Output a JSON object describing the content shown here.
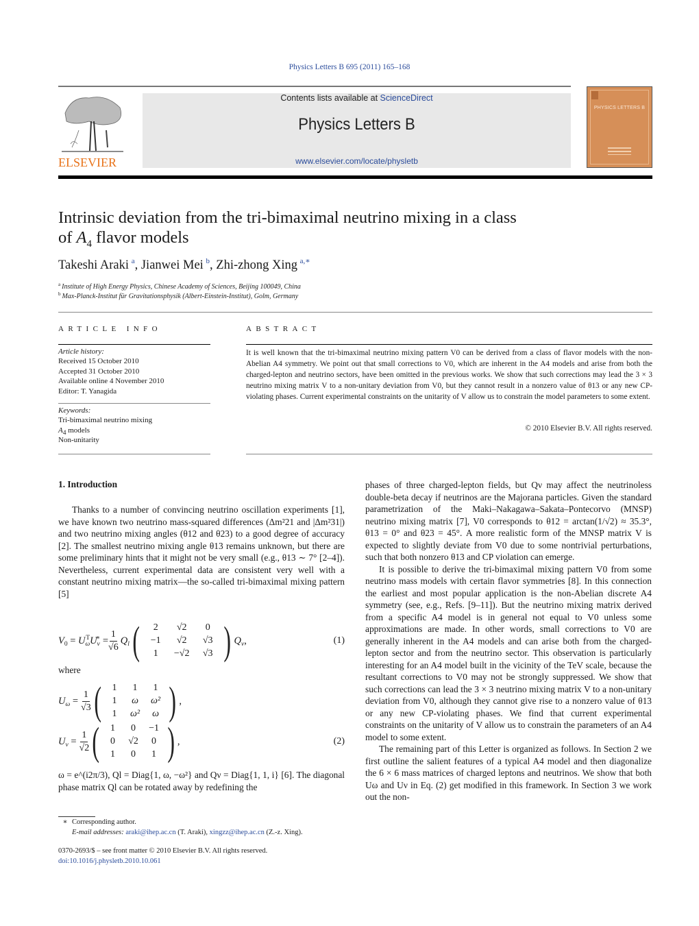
{
  "header": {
    "journal_ref": "Physics Letters B 695 (2011) 165–168",
    "contents_prefix": "Contents lists available at ",
    "contents_link": "ScienceDirect",
    "journal_title": "Physics Letters B",
    "journal_url": "www.elsevier.com/locate/physletb",
    "publisher_logo_text": "ELSEVIER",
    "cover_title": "PHYSICS LETTERS B",
    "colors": {
      "link": "#2b4c9b",
      "elsevier_orange": "#e8731a",
      "cover": "#d68f58",
      "band": "#e8e8e8"
    }
  },
  "article": {
    "title_line1": "Intrinsic deviation from the tri-bimaximal neutrino mixing in a class",
    "title_line2_pre": "of ",
    "title_line2_math": "A",
    "title_line2_sub": "4",
    "title_line2_post": " flavor models",
    "authors": [
      {
        "name": "Takeshi Araki",
        "marks": "a"
      },
      {
        "name": "Jianwei Mei",
        "marks": "b"
      },
      {
        "name": "Zhi-zhong Xing",
        "marks": "a,∗"
      }
    ],
    "affiliations": [
      {
        "mark": "a",
        "text": "Institute of High Energy Physics, Chinese Academy of Sciences, Beijing 100049, China"
      },
      {
        "mark": "b",
        "text": "Max-Planck-Institut für Gravitationsphysik (Albert-Einstein-Institut), Golm, Germany"
      }
    ]
  },
  "article_info": {
    "heading": "ARTICLE INFO",
    "history_label": "Article history:",
    "history": [
      "Received 15 October 2010",
      "Accepted 31 October 2010",
      "Available online 4 November 2010",
      "Editor: T. Yanagida"
    ],
    "keywords_label": "Keywords:",
    "keywords": [
      "Tri-bimaximal neutrino mixing",
      "A4 models",
      "Non-unitarity"
    ]
  },
  "abstract": {
    "heading": "ABSTRACT",
    "text": "It is well known that the tri-bimaximal neutrino mixing pattern V0 can be derived from a class of flavor models with the non-Abelian A4 symmetry. We point out that small corrections to V0, which are inherent in the A4 models and arise from both the charged-lepton and neutrino sectors, have been omitted in the previous works. We show that such corrections may lead the 3 × 3 neutrino mixing matrix V to a non-unitary deviation from V0, but they cannot result in a nonzero value of θ13 or any new CP-violating phases. Current experimental constraints on the unitarity of V allow us to constrain the model parameters to some extent.",
    "copyright": "© 2010 Elsevier B.V. All rights reserved."
  },
  "body": {
    "section1_heading": "1. Introduction",
    "intro_para": "Thanks to a number of convincing neutrino oscillation experiments [1], we have known two neutrino mass-squared differences (Δm²21 and |Δm²31|) and two neutrino mixing angles (θ12 and θ23) to a good degree of accuracy [2]. The smallest neutrino mixing angle θ13 remains unknown, but there are some preliminary hints that it might not be very small (e.g., θ13 ∼ 7° [2–4]). Nevertheless, current experimental data are consistent very well with a constant neutrino mixing matrix—the so-called tri-bimaximal mixing pattern [5]",
    "eq1": {
      "lhs": "V0 = UωT Uν* =",
      "prefactor_num": "1",
      "prefactor_den": "√6",
      "left": "Q",
      "left_sub": "l",
      "matrix": [
        "2",
        "√2",
        "0",
        "−1",
        "√2",
        "√3",
        "1",
        "−√2",
        "√3"
      ],
      "right": "Q",
      "right_sub": "ν",
      "number": "(1)"
    },
    "where": "where",
    "eq2a": {
      "lhs": "U",
      "lhs_sub": "ω",
      "prefactor_num": "1",
      "prefactor_den": "√3",
      "matrix": [
        "1",
        "1",
        "1",
        "1",
        "ω",
        "ω²",
        "1",
        "ω²",
        "ω"
      ]
    },
    "eq2b": {
      "lhs": "U",
      "lhs_sub": "ν",
      "prefactor_num": "1",
      "prefactor_den": "√2",
      "matrix": [
        "1",
        "0",
        "−1",
        "0",
        "√2",
        "0",
        "1",
        "0",
        "1"
      ],
      "number": "(2)"
    },
    "after_eq": "ω = e^(i2π/3), Ql = Diag{1, ω, −ω²} and Qν = Diag{1, 1, i} [6]. The diagonal phase matrix Ql can be rotated away by redefining the",
    "right_col_para1": "phases of three charged-lepton fields, but Qν may affect the neutrinoless double-beta decay if neutrinos are the Majorana particles. Given the standard parametrization of the Maki–Nakagawa–Sakata–Pontecorvo (MNSP) neutrino mixing matrix [7], V0 corresponds to θ12 = arctan(1/√2) ≈ 35.3°, θ13 = 0° and θ23 = 45°. A more realistic form of the MNSP matrix V is expected to slightly deviate from V0 due to some nontrivial perturbations, such that both nonzero θ13 and CP violation can emerge.",
    "right_col_para2": "It is possible to derive the tri-bimaximal mixing pattern V0 from some neutrino mass models with certain flavor symmetries [8]. In this connection the earliest and most popular application is the non-Abelian discrete A4 symmetry (see, e.g., Refs. [9–11]). But the neutrino mixing matrix derived from a specific A4 model is in general not equal to V0 unless some approximations are made. In other words, small corrections to V0 are generally inherent in the A4 models and can arise both from the charged-lepton sector and from the neutrino sector. This observation is particularly interesting for an A4 model built in the vicinity of the TeV scale, because the resultant corrections to V0 may not be strongly suppressed. We show that such corrections can lead the 3 × 3 neutrino mixing matrix V to a non-unitary deviation from V0, although they cannot give rise to a nonzero value of θ13 or any new CP-violating phases. We find that current experimental constraints on the unitarity of V allow us to constrain the parameters of an A4 model to some extent.",
    "right_col_para3": "The remaining part of this Letter is organized as follows. In Section 2 we first outline the salient features of a typical A4 model and then diagonalize the 6 × 6 mass matrices of charged leptons and neutrinos. We show that both Uω and Uν in Eq. (2) get modified in this framework. In Section 3 we work out the non-"
  },
  "footnotes": {
    "star_text": "Corresponding author.",
    "email_label": "E-mail addresses:",
    "email1": "araki@ihep.ac.cn",
    "email1_owner": "(T. Araki),",
    "email2": "xingzz@ihep.ac.cn",
    "email2_owner": "(Z.-z. Xing).",
    "front_matter": "0370-2693/$ – see front matter  © 2010 Elsevier B.V. All rights reserved.",
    "doi": "doi:10.1016/j.physletb.2010.10.061"
  }
}
